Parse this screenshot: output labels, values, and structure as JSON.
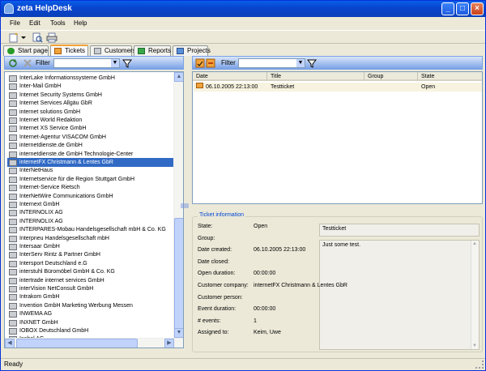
{
  "window": {
    "title": "zeta HelpDesk",
    "minimize": "_",
    "maximize": "□",
    "close": "×"
  },
  "menu": [
    "File",
    "Edit",
    "Tools",
    "Help"
  ],
  "tabs": [
    "Start page",
    "Tickets",
    "Customers",
    "Reports",
    "Projects"
  ],
  "left_filter": {
    "label": "Filter",
    "value": ""
  },
  "right_filter": {
    "label": "Filter",
    "value": ""
  },
  "customers": [
    "InterLake Informationssysteme GmbH",
    "Inter-Mail GmbH",
    "Internet Security Systems GmbH",
    "Internet Services Allgäu GbR",
    "internet solutions GmbH",
    "Internet World Redaktion",
    "Internet XS Service GmbH",
    "Internet-Agentur VISACOM GmbH",
    "internetdienste.de GmbH",
    "internetdienste.de GmbH Technologie-Center",
    "internetFX Christmann & Lentes GbR",
    "InterNetHaus",
    "Internetservice für die Region Stuttgart GmbH",
    "Internet-Service Rietsch",
    "InterNetWire Communications GmbH",
    "Internext GmbH",
    "INTERNOLIX AG",
    "INTERNOLIX AG",
    "INTERPARES-Mobau Handelsgesellschaft mbH & Co. KG",
    "Interpneu Handelsgesellschaft mbH",
    "Intersaar GmbH",
    "InterServ Rintz & Partner GmbH",
    "Intersport Deutschland e.G",
    "interstuhl Büromöbel GmbH & Co. KG",
    "intertrade internet services GmbH",
    "interVision NetConsult GmbH",
    "Intrakom GmbH",
    "Invention GmbH Marketing Werbung Messen",
    "INWEMA AG",
    "INXNET GmbH",
    "IOBOX Deutschland GmbH",
    "Isabel AG"
  ],
  "selected_customer_index": 10,
  "ticket_columns": [
    "Date",
    "Title",
    "Group",
    "State"
  ],
  "tickets": [
    {
      "date": "06.10.2005 22:13:00",
      "title": "Testticket",
      "group": "",
      "state": "Open"
    }
  ],
  "ticket_info": {
    "legend": "Ticket information",
    "rows": [
      {
        "label": "State:",
        "value": "Open"
      },
      {
        "label": "Group:",
        "value": ""
      },
      {
        "label": "Date created:",
        "value": "06.10.2005 22:13:00"
      },
      {
        "label": "Date closed:",
        "value": ""
      },
      {
        "label": "Open duration:",
        "value": "00:00:00"
      },
      {
        "label": "Customer company:",
        "value": "internetFX Christmann & Lentes GbR"
      },
      {
        "label": "Customer person:",
        "value": ""
      },
      {
        "label": "Event duration:",
        "value": "00:00:00"
      },
      {
        "label": "# events:",
        "value": "1"
      },
      {
        "label": "Assigned to:",
        "value": "Keim, Uwe"
      }
    ],
    "title_field": "Testticket",
    "description_field": "Just some test."
  },
  "status": "Ready"
}
